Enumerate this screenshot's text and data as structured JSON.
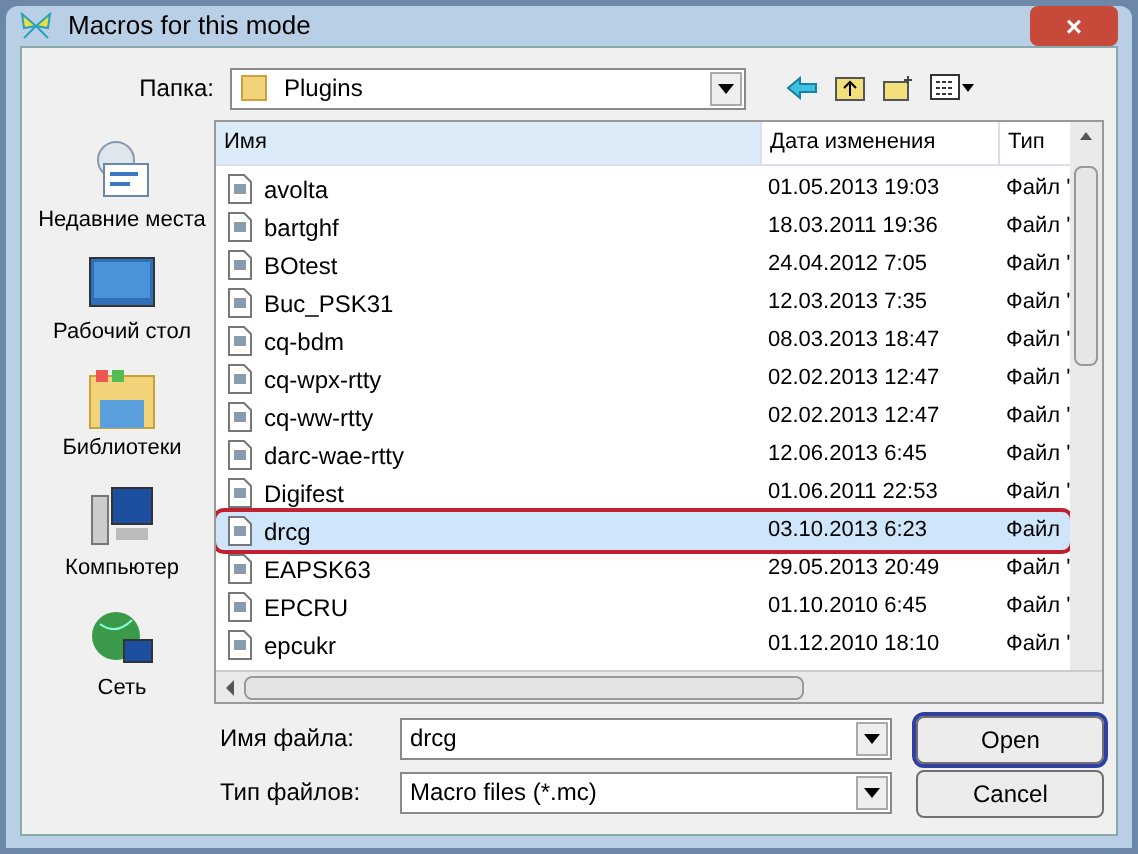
{
  "window": {
    "title": "Macros for this mode",
    "close": "×"
  },
  "folder": {
    "label": "Папка:",
    "value": "Plugins"
  },
  "places": [
    {
      "label": "Недавние места",
      "kind": "recent"
    },
    {
      "label": "Рабочий стол",
      "kind": "desktop"
    },
    {
      "label": "Библиотеки",
      "kind": "libraries"
    },
    {
      "label": "Компьютер",
      "kind": "computer"
    },
    {
      "label": "Сеть",
      "kind": "network"
    }
  ],
  "table": {
    "columns": [
      "Имя",
      "Дата изменения",
      "Тип"
    ],
    "rows": [
      {
        "name": "avolta",
        "date": "01.05.2013 19:03",
        "type": "Файл '",
        "selected": false
      },
      {
        "name": "bartghf",
        "date": "18.03.2011 19:36",
        "type": "Файл '",
        "selected": false
      },
      {
        "name": "BOtest",
        "date": "24.04.2012 7:05",
        "type": "Файл '",
        "selected": false
      },
      {
        "name": "Buc_PSK31",
        "date": "12.03.2013 7:35",
        "type": "Файл '",
        "selected": false
      },
      {
        "name": "cq-bdm",
        "date": "08.03.2013 18:47",
        "type": "Файл '",
        "selected": false
      },
      {
        "name": "cq-wpx-rtty",
        "date": "02.02.2013 12:47",
        "type": "Файл '",
        "selected": false
      },
      {
        "name": "cq-ww-rtty",
        "date": "02.02.2013 12:47",
        "type": "Файл '",
        "selected": false
      },
      {
        "name": "darc-wae-rtty",
        "date": "12.06.2013 6:45",
        "type": "Файл '",
        "selected": false
      },
      {
        "name": "Digifest",
        "date": "01.06.2011 22:53",
        "type": "Файл '",
        "selected": false
      },
      {
        "name": "drcg",
        "date": "03.10.2013 6:23",
        "type": "Файл",
        "selected": true
      },
      {
        "name": "EAPSK63",
        "date": "29.05.2013 20:49",
        "type": "Файл '",
        "selected": false
      },
      {
        "name": "EPCRU",
        "date": "01.10.2010 6:45",
        "type": "Файл '",
        "selected": false
      },
      {
        "name": "epcukr",
        "date": "01.12.2010 18:10",
        "type": "Файл '",
        "selected": false
      }
    ]
  },
  "filename": {
    "label": "Имя файла:",
    "value": "drcg"
  },
  "filetype": {
    "label": "Тип файлов:",
    "value": "Macro files (*.mc)"
  },
  "buttons": [
    {
      "label": "Open",
      "highlighted": true
    },
    {
      "label": "Cancel",
      "highlighted": false
    }
  ]
}
